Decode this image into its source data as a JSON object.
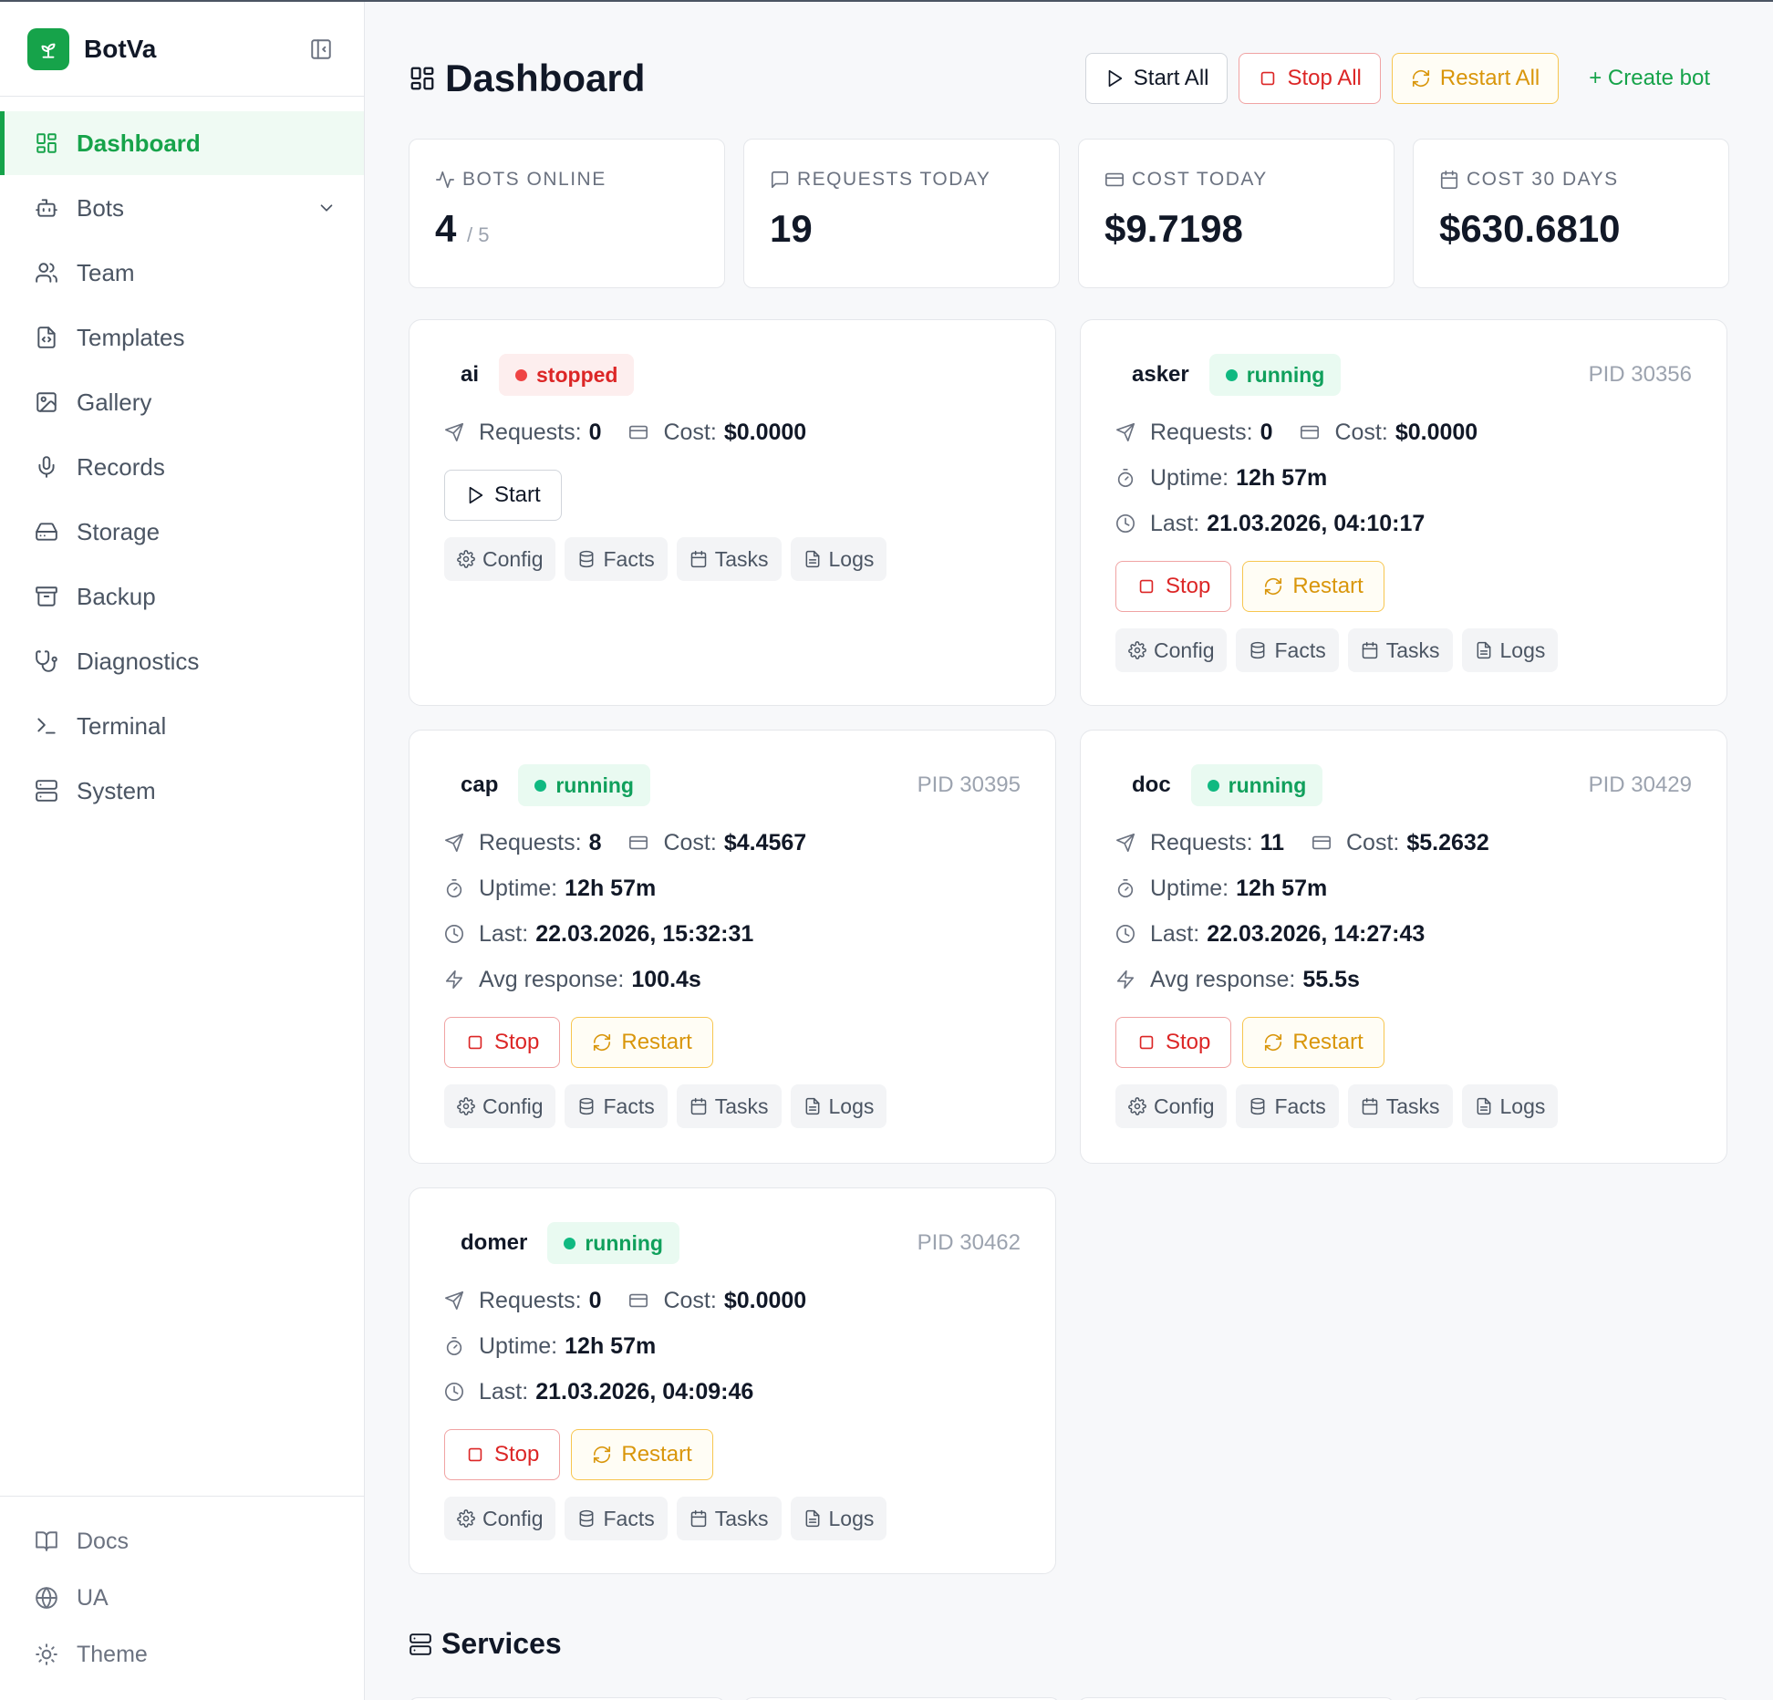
{
  "app": {
    "name": "BotVa"
  },
  "sidebar": {
    "items": [
      {
        "label": "Dashboard",
        "icon": "dashboard-icon",
        "active": true
      },
      {
        "label": "Bots",
        "icon": "bot-icon"
      },
      {
        "label": "Team",
        "icon": "users-icon"
      },
      {
        "label": "Templates",
        "icon": "file-code-icon"
      },
      {
        "label": "Gallery",
        "icon": "image-icon"
      },
      {
        "label": "Records",
        "icon": "mic-icon"
      },
      {
        "label": "Storage",
        "icon": "hard-drive-icon"
      },
      {
        "label": "Backup",
        "icon": "archive-icon"
      },
      {
        "label": "Diagnostics",
        "icon": "stethoscope-icon"
      },
      {
        "label": "Terminal",
        "icon": "terminal-icon"
      },
      {
        "label": "System",
        "icon": "server-icon"
      }
    ],
    "bottom": [
      {
        "label": "Docs",
        "icon": "book-icon"
      },
      {
        "label": "UA",
        "icon": "globe-icon"
      },
      {
        "label": "Theme",
        "icon": "sun-icon"
      }
    ]
  },
  "header": {
    "title": "Dashboard",
    "start_all": "Start All",
    "stop_all": "Stop All",
    "restart_all": "Restart All",
    "create_bot": "+ Create bot"
  },
  "stats": [
    {
      "label": "BOTS ONLINE",
      "value": "4",
      "sub": "/ 5",
      "icon": "activity-icon"
    },
    {
      "label": "REQUESTS TODAY",
      "value": "19",
      "icon": "message-icon"
    },
    {
      "label": "COST TODAY",
      "value": "$9.7198",
      "icon": "credit-card-icon"
    },
    {
      "label": "COST 30 DAYS",
      "value": "$630.6810",
      "icon": "calendar-icon"
    }
  ],
  "labels": {
    "requests": "Requests:",
    "cost": "Cost:",
    "uptime": "Uptime:",
    "last": "Last:",
    "avg": "Avg response:",
    "start": "Start",
    "stop": "Stop",
    "restart": "Restart",
    "config": "Config",
    "facts": "Facts",
    "tasks": "Tasks",
    "logs": "Logs"
  },
  "bots": [
    {
      "name": "ai",
      "status": "stopped",
      "pid": "",
      "requests": "0",
      "cost": "$0.0000"
    },
    {
      "name": "asker",
      "status": "running",
      "pid": "PID 30356",
      "requests": "0",
      "cost": "$0.0000",
      "uptime": "12h 57m",
      "last": "21.03.2026, 04:10:17"
    },
    {
      "name": "cap",
      "status": "running",
      "pid": "PID 30395",
      "requests": "8",
      "cost": "$4.4567",
      "uptime": "12h 57m",
      "last": "22.03.2026, 15:32:31",
      "avg": "100.4s"
    },
    {
      "name": "doc",
      "status": "running",
      "pid": "PID 30429",
      "requests": "11",
      "cost": "$5.2632",
      "uptime": "12h 57m",
      "last": "22.03.2026, 14:27:43",
      "avg": "55.5s"
    },
    {
      "name": "domer",
      "status": "running",
      "pid": "PID 30462",
      "requests": "0",
      "cost": "$0.0000",
      "uptime": "12h 57m",
      "last": "21.03.2026, 04:09:46"
    }
  ],
  "services": {
    "title": "Services"
  },
  "colors": {
    "accent": "#16a34a",
    "danger": "#dc2626",
    "warning": "#d9960b",
    "running": "#10b981"
  }
}
